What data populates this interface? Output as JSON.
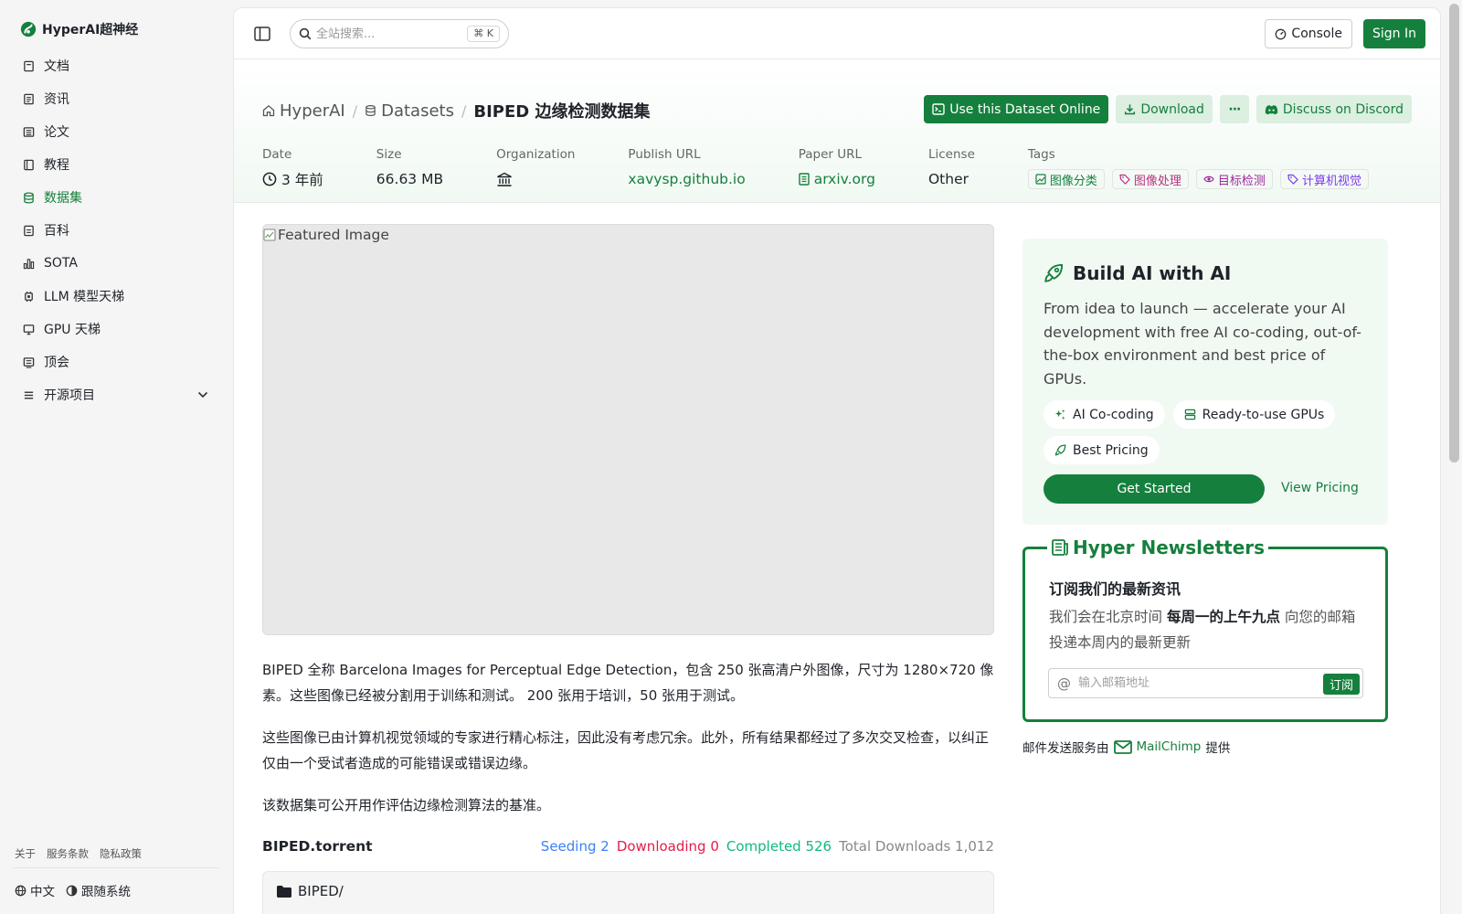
{
  "brand": {
    "name": "HyperAI超神经",
    "icon": "hyperai-logo-icon"
  },
  "sidebar": {
    "items": [
      {
        "label": "文档",
        "icon": "book-icon"
      },
      {
        "label": "资讯",
        "icon": "news-icon"
      },
      {
        "label": "论文",
        "icon": "paper-icon"
      },
      {
        "label": "教程",
        "icon": "tutorial-icon"
      },
      {
        "label": "数据集",
        "icon": "database-icon",
        "active": true
      },
      {
        "label": "百科",
        "icon": "wiki-icon"
      },
      {
        "label": "SOTA",
        "icon": "bar-chart-icon"
      },
      {
        "label": "LLM 模型天梯",
        "icon": "chip-icon"
      },
      {
        "label": "GPU 天梯",
        "icon": "monitor-icon"
      },
      {
        "label": "顶会",
        "icon": "conference-icon"
      },
      {
        "label": "开源项目",
        "icon": "list-icon",
        "expandable": true
      }
    ],
    "footer_links": [
      "关于",
      "服务条款",
      "隐私政策"
    ],
    "language": "中文",
    "theme": "跟随系统"
  },
  "topbar": {
    "search_placeholder": "全站搜索...",
    "search_shortcut": "⌘ K",
    "console_label": "Console",
    "signin_label": "Sign In"
  },
  "breadcrumb": {
    "home": "HyperAI",
    "section": "Datasets",
    "current": "BIPED 边缘检测数据集"
  },
  "actions": {
    "use_online": "Use this Dataset Online",
    "download": "Download",
    "more": "···",
    "discord": "Discuss on Discord"
  },
  "meta": {
    "date_label": "Date",
    "date_value": "3 年前",
    "size_label": "Size",
    "size_value": "66.63 MB",
    "org_label": "Organization",
    "publish_label": "Publish URL",
    "publish_value": "xavysp.github.io",
    "paper_label": "Paper URL",
    "paper_value": "arxiv.org",
    "license_label": "License",
    "license_value": "Other",
    "tags_label": "Tags",
    "tags": [
      "图像分类",
      "图像处理",
      "目标检测",
      "计算机视觉"
    ]
  },
  "featured_alt": "Featured Image",
  "description": {
    "p1": "BIPED 全称 Barcelona Images for Perceptual Edge Detection，包含 250 张高清户外图像，尺寸为 1280×720 像素。这些图像已经被分割用于训练和测试。 200 张用于培训，50 张用于测试。",
    "p2": "这些图像已由计算机视觉领域的专家进行精心标注，因此没有考虑冗余。此外，所有结果都经过了多次交叉检查，以纠正仅由一个受试者造成的可能错误或错误边缘。",
    "p3": "该数据集可公开用作评估边缘检测算法的基准。"
  },
  "torrent": {
    "name": "BIPED.torrent",
    "seeding": "Seeding 2",
    "downloading": "Downloading 0",
    "completed": "Completed 526",
    "total": "Total Downloads 1,012",
    "folder": "BIPED/"
  },
  "promo": {
    "title": "Build AI with AI",
    "text": "From idea to launch — accelerate your AI development with free AI co-coding, out-of-the-box environment and best price of GPUs.",
    "chips": [
      "AI Co-coding",
      "Ready-to-use GPUs",
      "Best Pricing"
    ],
    "cta": "Get Started",
    "pricing": "View Pricing"
  },
  "newsletter": {
    "title": "Hyper Newsletters",
    "subtitle": "订阅我们的最新资讯",
    "desc_pre": "我们会在北京时间",
    "desc_bold": "每周一的上午九点",
    "desc_post": "向您的邮箱投递本周内的最新更新",
    "placeholder": "输入邮箱地址",
    "subscribe": "订阅",
    "provider_pre": "邮件发送服务由",
    "provider": "MailChimp",
    "provider_post": "提供"
  },
  "colors": {
    "accent": "#15803d",
    "accent_light": "#dcefe1"
  }
}
